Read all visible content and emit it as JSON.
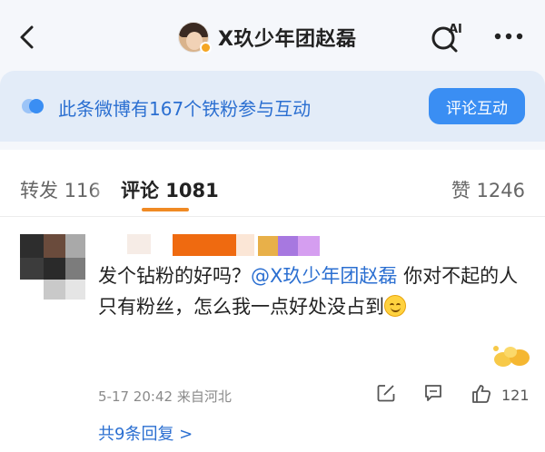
{
  "nav": {
    "title": "X玖少年团赵磊",
    "back_icon": "chevron-left-icon",
    "ai_icon": "ai-search-icon",
    "more_icon": "more-dots-icon",
    "ai_label": "AI"
  },
  "fan_banner": {
    "text": "此条微博有167个铁粉参与互动",
    "button_label": "评论互动",
    "accent": "#3a8ef3"
  },
  "tabs": {
    "repost": "转发 116",
    "comment": "评论 1081",
    "like": "赞 1246",
    "active_color": "#f08a24"
  },
  "comment": {
    "text_before": "发个钻粉的好吗？",
    "mention": "@X玖少年团赵磊",
    "text_after": " 你对不起的人只有粉丝，怎么我一点好处没占到",
    "time": "5-17 20:42",
    "location": "来自河北",
    "like_count": "121",
    "replies": "共9条回复 >",
    "share_icon": "share-icon",
    "comment_icon": "comment-icon",
    "like_icon": "thumbs-up-icon"
  }
}
